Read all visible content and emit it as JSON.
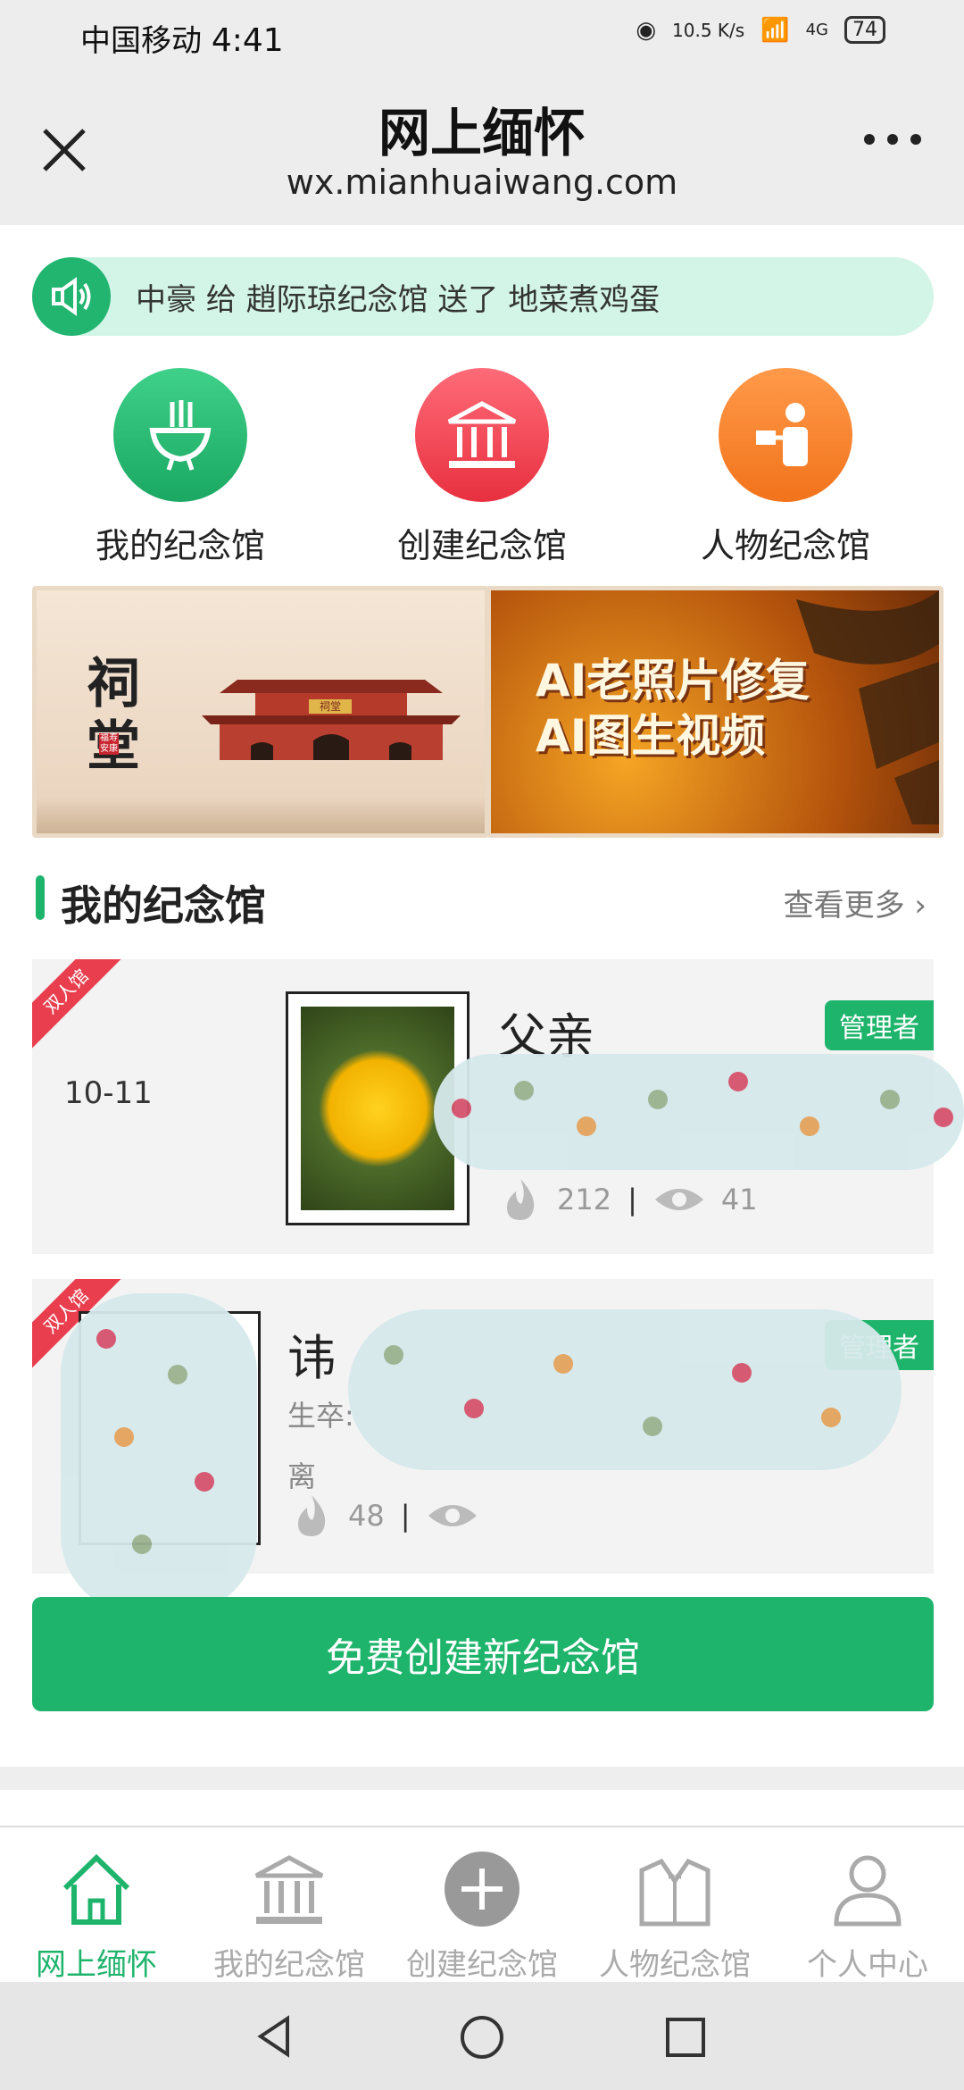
{
  "status_bar": {
    "carrier": "中国移动",
    "time": "4:41",
    "net_speed": "10.5 K/s",
    "network": "4G",
    "battery": "74"
  },
  "header": {
    "title": "网上缅怀",
    "subtitle": "wx.mianhuaiwang.com"
  },
  "notice": {
    "text": "中豪 给 趙际琼纪念馆 送了 地菜煮鸡蛋"
  },
  "quick_actions": [
    {
      "label": "我的纪念馆",
      "color": "#21b56f",
      "icon": "incense-burner-icon"
    },
    {
      "label": "创建纪念馆",
      "color": "#ef3f52",
      "icon": "temple-icon"
    },
    {
      "label": "人物纪念馆",
      "color": "#f57f2a",
      "icon": "person-icon"
    }
  ],
  "banners": {
    "left": {
      "title": "祠堂",
      "seal": "福寿安康",
      "gate": "祠堂"
    },
    "right": {
      "line1": "AI老照片修复",
      "line2": "AI图生视频"
    }
  },
  "section": {
    "title": "我的纪念馆",
    "more": "查看更多"
  },
  "memorials": [
    {
      "ribbon": "双人馆",
      "date": "10-11",
      "name": "父亲",
      "role": "管理者",
      "flowers": "212",
      "views": "41"
    },
    {
      "ribbon": "双人馆",
      "name": "讳",
      "role": "管理者",
      "life_label": "生卒:",
      "left_label": "离",
      "flowers": "48"
    }
  ],
  "create_button": "免费创建新纪念馆",
  "bottom_nav": [
    {
      "label": "网上缅怀",
      "icon": "home-icon",
      "active": true
    },
    {
      "label": "我的纪念馆",
      "icon": "temple-icon",
      "active": false
    },
    {
      "label": "创建纪念馆",
      "icon": "plus-circle-icon",
      "active": false
    },
    {
      "label": "人物纪念馆",
      "icon": "tuxedo-icon",
      "active": false
    },
    {
      "label": "个人中心",
      "icon": "user-icon",
      "active": false
    }
  ],
  "colors": {
    "accent": "#1fb46c",
    "ribbon": "#e93e4e"
  }
}
